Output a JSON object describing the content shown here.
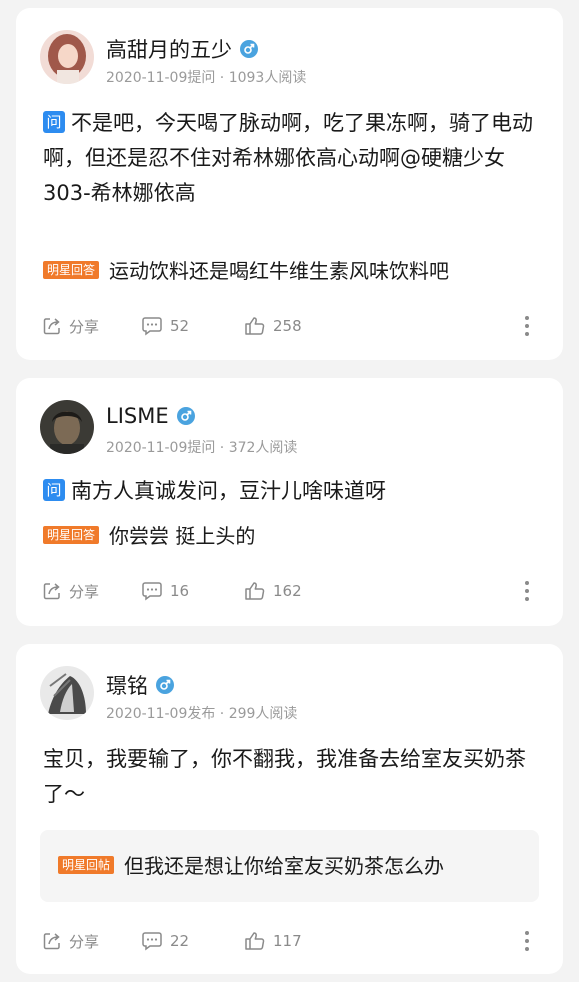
{
  "posts": [
    {
      "user": "高甜月的五少",
      "meta": "2020-11-09提问 · 1093人阅读",
      "question_tag": "问",
      "question": "不是吧，今天喝了脉动啊，吃了果冻啊，骑了电动啊，但还是忍不住对希林娜依高心动啊@硬糖少女303-希林娜依高",
      "answer_tag": "明星回答",
      "answer": "运动饮料还是喝红牛维生素风味饮料吧",
      "share": "分享",
      "comments": "52",
      "likes": "258"
    },
    {
      "user": "LISME",
      "meta": "2020-11-09提问 · 372人阅读",
      "question_tag": "问",
      "question": "南方人真诚发问，豆汁儿啥味道呀",
      "answer_tag": "明星回答",
      "answer": "你尝尝 挺上头的",
      "share": "分享",
      "comments": "16",
      "likes": "162"
    },
    {
      "user": "璟铭",
      "meta": "2020-11-09发布 · 299人阅读",
      "post": "宝贝，我要输了，你不翻我，我准备去给室友买奶茶了～",
      "answer_tag": "明星回帖",
      "answer": "但我还是想让你给室友买奶茶怎么办",
      "share": "分享",
      "comments": "22",
      "likes": "117"
    }
  ],
  "colors": {
    "question_tag": "#2d8cf0",
    "answer_tag": "#f07a2a",
    "gender": "#4aa3df"
  },
  "icons": [
    "male-icon",
    "share-icon",
    "comment-icon",
    "like-icon",
    "more-icon"
  ]
}
